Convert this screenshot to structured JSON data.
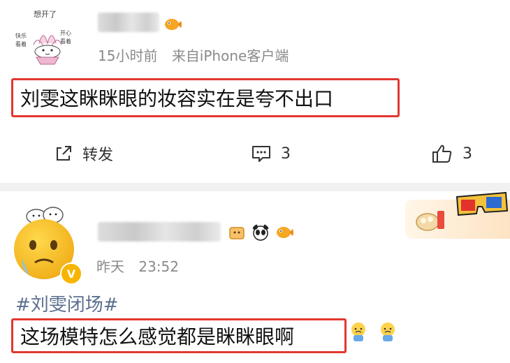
{
  "post1": {
    "avatar_text": [
      "想开了",
      "快乐",
      "开心",
      "看着",
      "看着"
    ],
    "meta": {
      "time": "15小时前",
      "source": "来自iPhone客户端"
    },
    "content": "刘雯这眯眯眼的妆容实在是夸不出口",
    "actions": {
      "repost_label": "转发",
      "comment_count": "3",
      "like_count": "3"
    }
  },
  "post2": {
    "meta": {
      "time": "昨天",
      "clock": "23:52"
    },
    "verified_mark": "V",
    "hashtag": "#刘雯闭场#",
    "content": "这场模特怎么感觉都是眯眯眼啊"
  },
  "colors": {
    "highlight_border": "#e2382f",
    "meta_gray": "#8a8a8a",
    "hashtag": "#5b6f8f"
  }
}
